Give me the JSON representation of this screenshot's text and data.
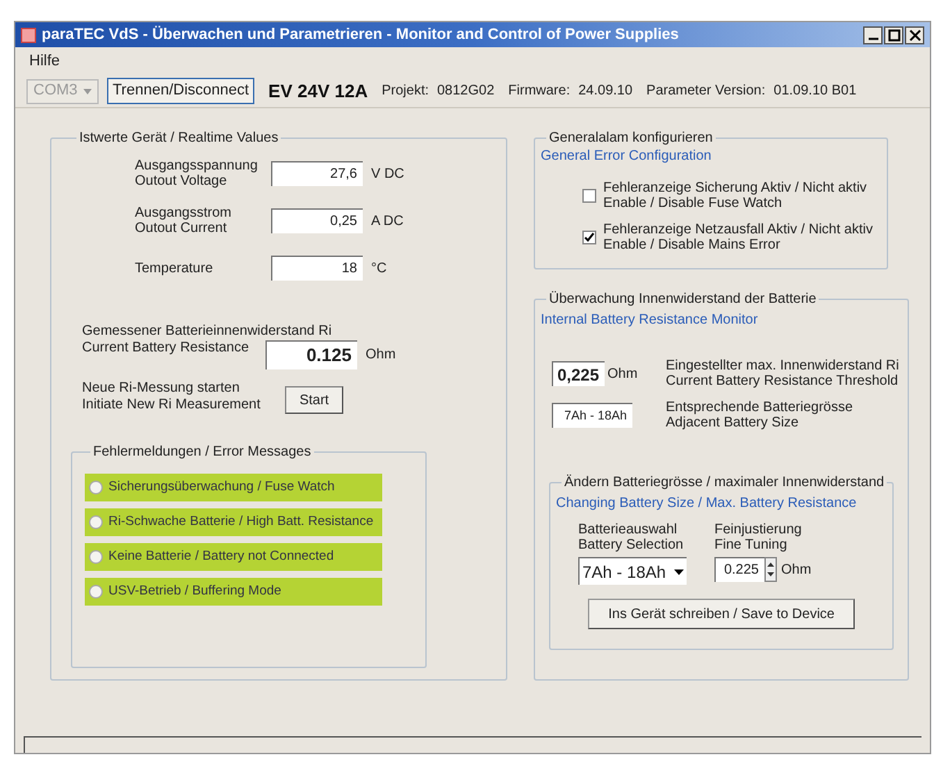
{
  "window": {
    "title": "paraTEC VdS - Überwachen und Parametrieren  - Monitor and Control of Power Supplies"
  },
  "menu": [
    "Hilfe"
  ],
  "toolbar": {
    "port": {
      "value": "COM3",
      "disabled": true
    },
    "disconnect": "Trennen/Disconnect",
    "device": "EV 24V 12A",
    "info": [
      {
        "label": "Projekt:",
        "value": "0812G02"
      },
      {
        "label": "Firmware:",
        "value": "24.09.10"
      },
      {
        "label": "Parameter Version:",
        "value": "01.09.10 B01"
      }
    ]
  },
  "realtime": {
    "title": "Istwerte Gerät / Realtime Values",
    "measurements": [
      {
        "lines": [
          "Ausgangsspannung",
          "Outout Voltage"
        ],
        "value": "27,6",
        "unit": "V DC"
      },
      {
        "lines": [
          "Ausgangsstrom",
          "Outout Current"
        ],
        "value": "0,25",
        "unit": "A DC"
      },
      {
        "lines": [
          "Temperature"
        ],
        "value": "18",
        "unit": "°C"
      }
    ],
    "resistance": {
      "lines": [
        "Gemessener Batterieinnenwiderstand Ri",
        "Current Battery Resistance"
      ],
      "value": "0.125",
      "unit": "Ohm"
    },
    "measure": {
      "lines": [
        "Neue Ri-Messung starten",
        "Initiate New Ri Measurement"
      ],
      "button": "Start"
    },
    "errors": {
      "title": "Fehlermeldungen / Error Messages",
      "items": [
        {
          "label": "Sicherungsüberwachung / Fuse Watch",
          "selected": false
        },
        {
          "label": "Ri-Schwache Batterie / High Batt. Resistance",
          "selected": false
        },
        {
          "label": "Keine Batterie / Battery not Connected",
          "selected": false
        },
        {
          "label": "USV-Betrieb / Buffering Mode",
          "selected": false
        }
      ]
    }
  },
  "general_error": {
    "title": "Generalalam konfigurieren",
    "subtitle": "General Error Configuration",
    "options": [
      {
        "lines": [
          "Fehleranzeige Sicherung Aktiv / Nicht aktiv",
          "Enable / Disable Fuse Watch"
        ],
        "checked": false
      },
      {
        "lines": [
          "Fehleranzeige Netzausfall Aktiv / Nicht aktiv",
          "Enable / Disable Mains Error"
        ],
        "checked": true
      }
    ]
  },
  "battery_monitor": {
    "title": "Überwachung Innenwiderstand der Batterie",
    "subtitle": "Internal Battery Resistance Monitor",
    "threshold": {
      "value": "0,225",
      "unit": "Ohm",
      "lines": [
        "Eingestellter max. Innenwiderstand Ri",
        "Current Battery Resistance Threshold"
      ]
    },
    "size": {
      "value": "7Ah - 18Ah",
      "lines": [
        "Entsprechende Batteriegrösse",
        "Adjacent Battery Size"
      ]
    },
    "change": {
      "title": "Ändern Batteriegrösse / maximaler Innenwiderstand",
      "subtitle": "Changing Battery Size / Max. Battery Resistance",
      "selection": {
        "lines": [
          "Batterieauswahl",
          "Battery Selection"
        ],
        "value": "7Ah - 18Ah"
      },
      "tuning": {
        "lines": [
          "Feinjustierung",
          "Fine Tuning"
        ],
        "value": "0.225",
        "unit": "Ohm"
      },
      "button": "Ins Gerät schreiben / Save to Device"
    }
  }
}
